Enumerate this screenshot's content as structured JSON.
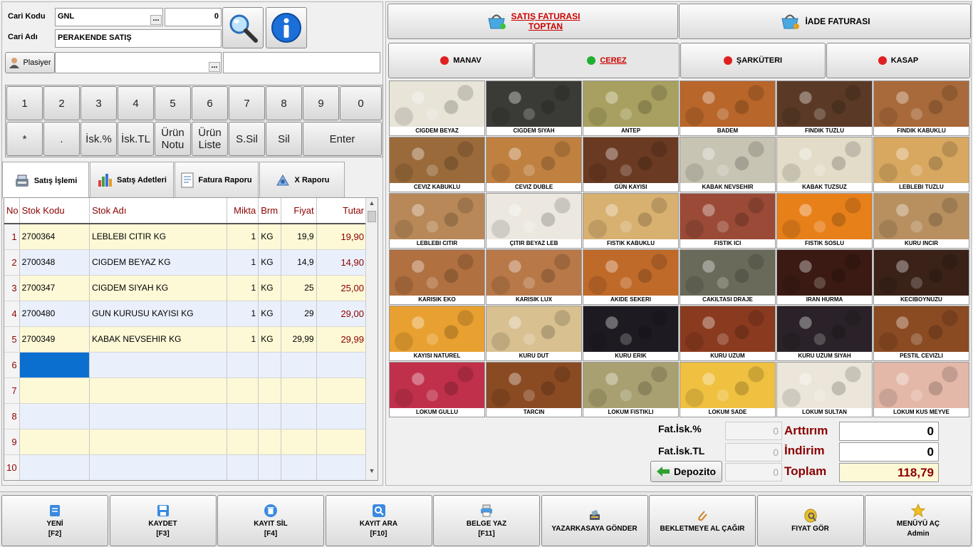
{
  "customer": {
    "code_label": "Cari Kodu",
    "code_value": "GNL",
    "code_number": "0",
    "name_label": "Cari Adı",
    "name_value": "PERAKENDE SATIŞ",
    "plasiyer_label": "Plasiyer",
    "plasiyer_value": "",
    "extra_value": "",
    "dots": "..."
  },
  "keypad": {
    "row1": [
      "1",
      "2",
      "3",
      "4",
      "5",
      "6",
      "7",
      "8",
      "9",
      "0"
    ],
    "row2": [
      "*",
      ".",
      "İsk.%",
      "İsk.TL",
      "Ürün Notu",
      "Ürün Liste",
      "S.Sil",
      "Sil",
      "Enter"
    ]
  },
  "tabs": [
    {
      "label": "Satış İşlemi",
      "icon": "cash-register-icon",
      "active": true
    },
    {
      "label": "Satış Adetleri",
      "icon": "bar-chart-icon",
      "active": false
    },
    {
      "label": "Fatura Raporu",
      "icon": "document-icon",
      "active": false
    },
    {
      "label": "X Raporu",
      "icon": "report-icon",
      "active": false
    }
  ],
  "grid": {
    "columns": [
      "No",
      "Stok Kodu",
      "Stok Adı",
      "Mikta",
      "Brm",
      "Fiyat",
      "Tutar"
    ],
    "rows": [
      {
        "no": "1",
        "kod": "2700364",
        "ad": "LEBLEBI CITIR KG",
        "miktar": "1",
        "brm": "KG",
        "fiyat": "19,9",
        "tutar": "19,90"
      },
      {
        "no": "2",
        "kod": "2700348",
        "ad": "CIGDEM BEYAZ KG",
        "miktar": "1",
        "brm": "KG",
        "fiyat": "14,9",
        "tutar": "14,90"
      },
      {
        "no": "3",
        "kod": "2700347",
        "ad": "CIGDEM SIYAH KG",
        "miktar": "1",
        "brm": "KG",
        "fiyat": "25",
        "tutar": "25,00"
      },
      {
        "no": "4",
        "kod": "2700480",
        "ad": "GUN KURUSU KAYISI KG",
        "miktar": "1",
        "brm": "KG",
        "fiyat": "29",
        "tutar": "29,00"
      },
      {
        "no": "5",
        "kod": "2700349",
        "ad": "KABAK NEVSEHIR KG",
        "miktar": "1",
        "brm": "KG",
        "fiyat": "29,99",
        "tutar": "29,99"
      },
      {
        "no": "6",
        "kod": "",
        "ad": "",
        "miktar": "",
        "brm": "",
        "fiyat": "",
        "tutar": ""
      },
      {
        "no": "7",
        "kod": "",
        "ad": "",
        "miktar": "",
        "brm": "",
        "fiyat": "",
        "tutar": ""
      },
      {
        "no": "8",
        "kod": "",
        "ad": "",
        "miktar": "",
        "brm": "",
        "fiyat": "",
        "tutar": ""
      },
      {
        "no": "9",
        "kod": "",
        "ad": "",
        "miktar": "",
        "brm": "",
        "fiyat": "",
        "tutar": ""
      },
      {
        "no": "10",
        "kod": "",
        "ad": "",
        "miktar": "",
        "brm": "",
        "fiyat": "",
        "tutar": ""
      }
    ]
  },
  "invoice_buttons": {
    "sale_line1": "SATIŞ FATURASI",
    "sale_line2": "TOPTAN",
    "return": "İADE FATURASI"
  },
  "categories": [
    {
      "label": "MANAV",
      "dot_color": "#e02020",
      "active": false
    },
    {
      "label": "CEREZ",
      "dot_color": "#20b030",
      "active": true
    },
    {
      "label": "ŞARKÜTERI",
      "dot_color": "#e02020",
      "active": false
    },
    {
      "label": "KASAP",
      "dot_color": "#e02020",
      "active": false
    }
  ],
  "products": [
    {
      "name": "CIGDEM BEYAZ",
      "color": "#e8e4d8"
    },
    {
      "name": "CIGDEM SIYAH",
      "color": "#3a3a36"
    },
    {
      "name": "ANTEP",
      "color": "#a8a060"
    },
    {
      "name": "BADEM",
      "color": "#b8662a"
    },
    {
      "name": "FINDIK TUZLU",
      "color": "#5a3a26"
    },
    {
      "name": "FINDIK KABUKLU",
      "color": "#a86a3a"
    },
    {
      "name": "CEVIZ KABUKLU",
      "color": "#9a6a3a"
    },
    {
      "name": "CEVIZ DUBLE",
      "color": "#c08040"
    },
    {
      "name": "GÜN KAYISI",
      "color": "#6a3a22"
    },
    {
      "name": "KABAK NEVSEHIR",
      "color": "#c8c4b4"
    },
    {
      "name": "KABAK TUZSUZ",
      "color": "#e2dcc8"
    },
    {
      "name": "LEBLEBI TUZLU",
      "color": "#d8a860"
    },
    {
      "name": "LEBLEBI CITIR",
      "color": "#b88858"
    },
    {
      "name": "ÇITIR BEYAZ LEB",
      "color": "#ece8e0"
    },
    {
      "name": "FISTIK KABUKLU",
      "color": "#d8b070"
    },
    {
      "name": "FISTIK ICI",
      "color": "#9a4a36"
    },
    {
      "name": "FISTIK SOSLU",
      "color": "#e8801a"
    },
    {
      "name": "KURU INCIR",
      "color": "#b89060"
    },
    {
      "name": "KARISIK EKO",
      "color": "#b07040"
    },
    {
      "name": "KARISIK LUX",
      "color": "#b87848"
    },
    {
      "name": "AKIDE SEKERI",
      "color": "#c06a2a"
    },
    {
      "name": "CAKILTASI DRAJE",
      "color": "#6a6a5a"
    },
    {
      "name": "IRAN HURMA",
      "color": "#3a1a12"
    },
    {
      "name": "KECIBOYNUZU",
      "color": "#3a2218"
    },
    {
      "name": "KAYISI NATUREL",
      "color": "#e8a030"
    },
    {
      "name": "KURU DUT",
      "color": "#d8c090"
    },
    {
      "name": "KURU ERIK",
      "color": "#1e1a22"
    },
    {
      "name": "KURU UZUM",
      "color": "#8a3a1e"
    },
    {
      "name": "KURU UZUM SIYAH",
      "color": "#2a2228"
    },
    {
      "name": "PESTIL CEVIZLI",
      "color": "#8a4a22"
    },
    {
      "name": "LOKUM GULLU",
      "color": "#c0304a"
    },
    {
      "name": "TARCIN",
      "color": "#8a4a22"
    },
    {
      "name": "LOKUM FISTIKLI",
      "color": "#a8a070"
    },
    {
      "name": "LOKUM SADE",
      "color": "#f0c040"
    },
    {
      "name": "LOKUM SULTAN",
      "color": "#ece6da"
    },
    {
      "name": "LOKUM KUS MEYVE",
      "color": "#e4b8a8"
    }
  ],
  "totals": {
    "fat_isk_pct_label": "Fat.İsk.%",
    "fat_isk_pct_value": "0",
    "fat_isk_tl_label": "Fat.İsk.TL",
    "fat_isk_tl_value": "0",
    "depozito_label": "Depozito",
    "depozito_value": "0",
    "arttirim_label": "Arttırım",
    "arttirim_value": "0",
    "indirim_label": "İndirim",
    "indirim_value": "0",
    "toplam_label": "Toplam",
    "toplam_value": "118,79"
  },
  "toolbar": [
    {
      "line1": "YENİ",
      "line2": "[F2]",
      "icon": "new-document-icon"
    },
    {
      "line1": "KAYDET",
      "line2": "[F3]",
      "icon": "save-icon"
    },
    {
      "line1": "KAYIT SİL",
      "line2": "[F4]",
      "icon": "trash-icon"
    },
    {
      "line1": "KAYIT ARA",
      "line2": "[F10]",
      "icon": "search-icon"
    },
    {
      "line1": "BELGE YAZ",
      "line2": "[F11]",
      "icon": "printer-icon"
    },
    {
      "line1": "YAZARKASAYA GÖNDER",
      "line2": "",
      "icon": "cash-register-icon"
    },
    {
      "line1": "BEKLETMEYE AL ÇAĞIR",
      "line2": "",
      "icon": "paperclip-icon"
    },
    {
      "line1": "FIYAT GÖR",
      "line2": "",
      "icon": "price-tag-icon"
    },
    {
      "line1": "MENÜYÜ AÇ",
      "line2": "Admin",
      "icon": "star-icon"
    }
  ],
  "colors": {
    "accent_red": "#8b0000",
    "link_red": "#cc0000",
    "selected_cell": "#0b6fd0",
    "row_odd": "#fdf8d6",
    "row_even": "#eaf0fb"
  }
}
